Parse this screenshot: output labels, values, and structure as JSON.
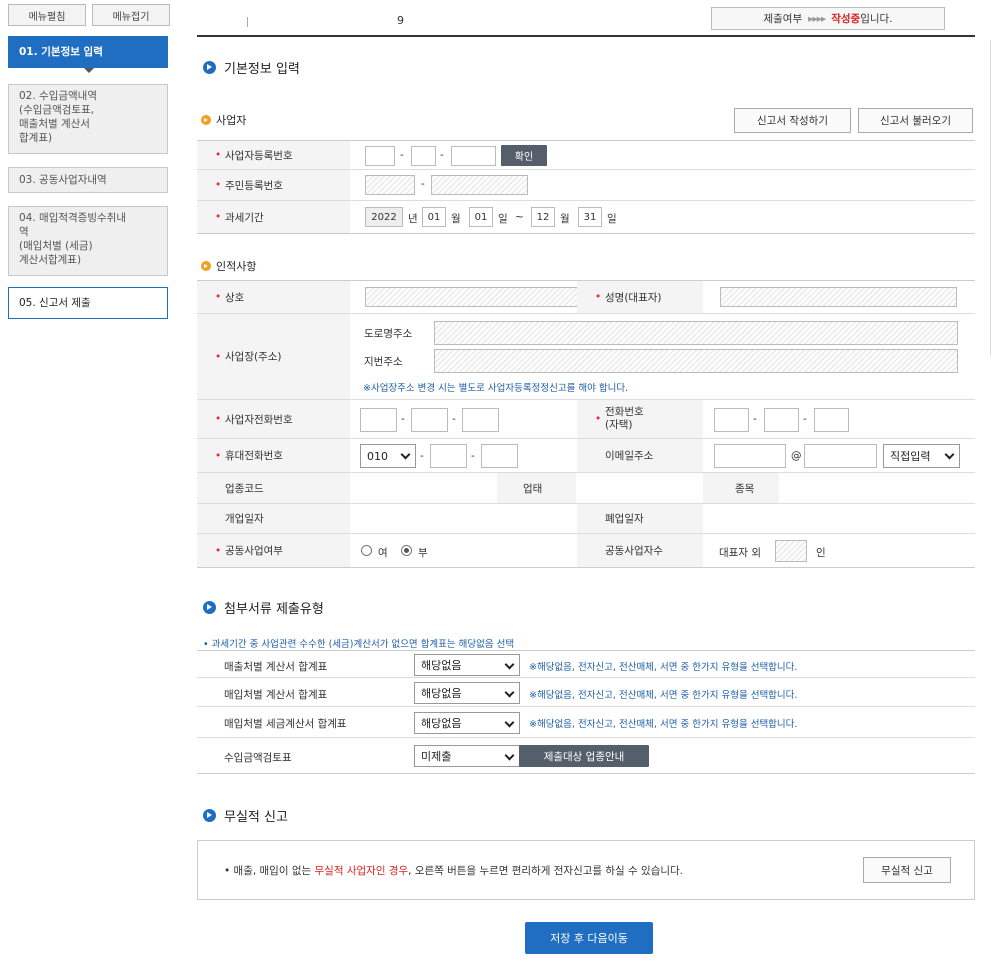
{
  "menu": {
    "expand": "메뉴펼침",
    "collapse": "메뉴접기"
  },
  "nav": [
    "01. 기본정보 입력",
    "02. 수입금액내역\n    (수입금액검토표,\n    매출처별 계산서\n    합계표)",
    "03. 공동사업자내역",
    "04. 매입적격증빙수취내\n역\n(매입처별 (세금)\n계산서합계표)",
    "05. 신고서 제출"
  ],
  "top": {
    "digit": "9",
    "status_label": "제출여부",
    "status_arrows": "▸▸▸▸",
    "status_value": "작성중",
    "status_suffix": "입니다."
  },
  "basic": {
    "title": "기본정보 입력",
    "biz_title": "사업자",
    "write_btn": "신고서 작성하기",
    "load_btn": "신고서 불러오기",
    "biz_no": "사업자등록번호",
    "confirm": "확인",
    "resident_no": "주민등록번호",
    "period": "과세기간",
    "year": "2022",
    "y_unit": "년",
    "m1": "01",
    "m_unit": "월",
    "d1": "01",
    "d_unit": "일",
    "tilde": "~",
    "m2": "12",
    "d2": "31",
    "dash": "-"
  },
  "personal": {
    "title": "인적사항",
    "company": "상호",
    "ceo": "성명(대표자)",
    "address": "사업장(주소)",
    "road": "도로명주소",
    "jibun": "지번주소",
    "addr_note": "※사업장주소 변경 시는 별도로 사업자등록정정신고를 해야 합니다.",
    "biz_phone": "사업자전화번호",
    "home_phone_1": "전화번호",
    "home_phone_2": "(자택)",
    "mobile": "휴대전화번호",
    "mobile_prefix": "010",
    "email": "이메일주소",
    "at": "@",
    "email_domain": "직접입력",
    "industry_code": "업종코드",
    "business_type": "업태",
    "business_item": "종목",
    "open_date": "개업일자",
    "close_date": "폐업일자",
    "joint": "공동사업여부",
    "yes": "여",
    "no": "부",
    "joint_count": "공동사업자수",
    "rep_other": "대표자 외",
    "persons": "인"
  },
  "attach": {
    "title": "첨부서류 제출유형",
    "hint": "• 과세기간 중 사업관련 수수한 (세금)계산서가 없으면 합계표는 해당없음 선택",
    "rows": [
      {
        "label": "매출처별 계산서 합계표",
        "value": "해당없음",
        "note": "※해당없음, 전자신고, 전산매체, 서면 중 한가지 유형을 선택합니다."
      },
      {
        "label": "매입처별 계산서 합계표",
        "value": "해당없음",
        "note": "※해당없음, 전자신고, 전산매체, 서면 중 한가지 유형을 선택합니다."
      },
      {
        "label": "매입처별 세금계산서 합계표",
        "value": "해당없음",
        "note": "※해당없음, 전자신고, 전산매체, 서면 중 한가지 유형을 선택합니다."
      },
      {
        "label": "수입금액검토표",
        "value": "미제출",
        "note": ""
      }
    ],
    "guide_btn": "제출대상 업종안내"
  },
  "nil": {
    "title": "무실적 신고",
    "msg_1": "• 매출, 매입이 없는 ",
    "msg_red": "무실적 사업자인 경우",
    "msg_2": ", 오른쪽 버튼을 누르면 편리하게 전자신고를 하실 수 있습니다.",
    "btn": "무실적 신고"
  },
  "save": "저장 후 다음이동",
  "colors": {
    "primary": "#1f6ec1",
    "required": "#e0302c",
    "note": "#1e5ea8"
  }
}
